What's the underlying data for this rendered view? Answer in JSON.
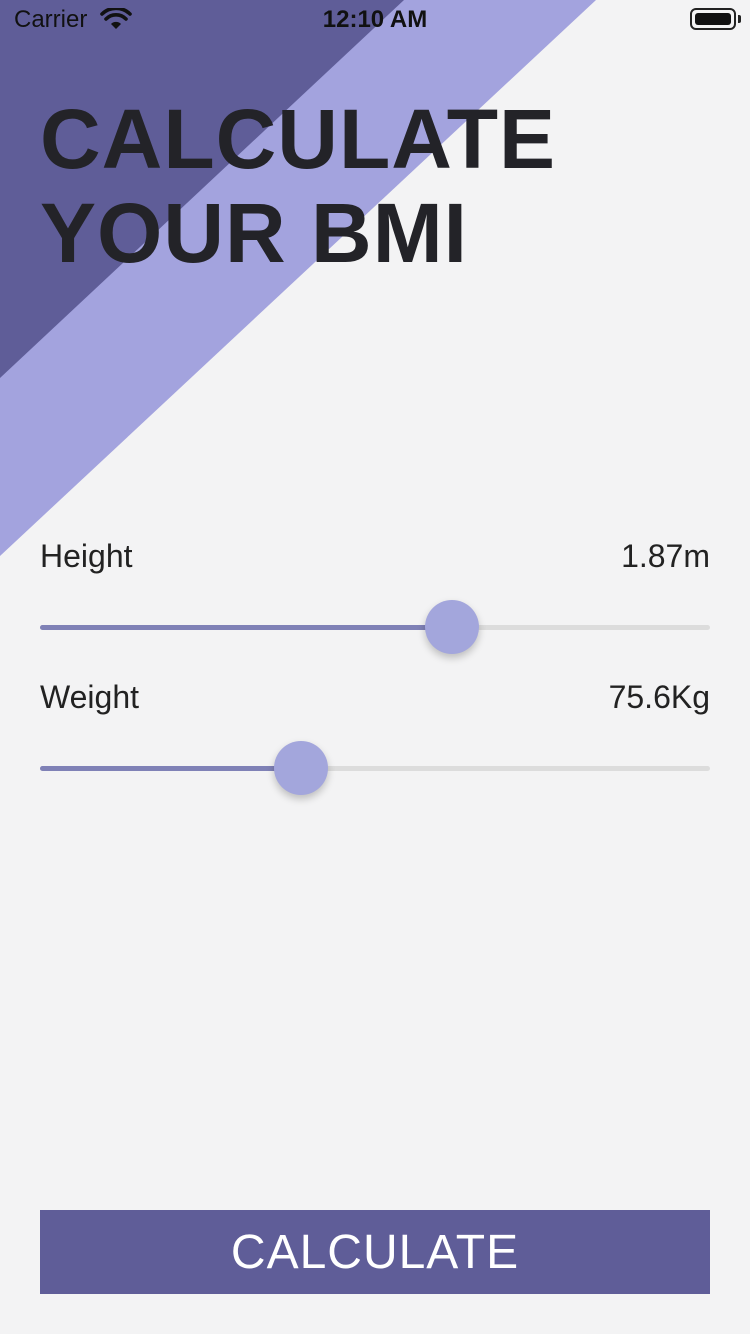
{
  "status_bar": {
    "carrier": "Carrier",
    "time": "12:10 AM",
    "icons": [
      "wifi-icon",
      "battery-icon"
    ]
  },
  "header": {
    "title_line1": "CALCULATE",
    "title_line2": "YOUR BMI"
  },
  "height": {
    "label": "Height",
    "value": "1.87m",
    "slider_fraction": 0.615
  },
  "weight": {
    "label": "Weight",
    "value": "75.6Kg",
    "slider_fraction": 0.39
  },
  "calculate_button": {
    "label": "CALCULATE"
  },
  "colors": {
    "background": "#f3f3f4",
    "dark_stripe": "#5f5d98",
    "light_stripe": "#a3a3de",
    "slider_fill": "#7f81b6",
    "slider_thumb": "#a3a6dc",
    "button": "#5f5d98"
  }
}
